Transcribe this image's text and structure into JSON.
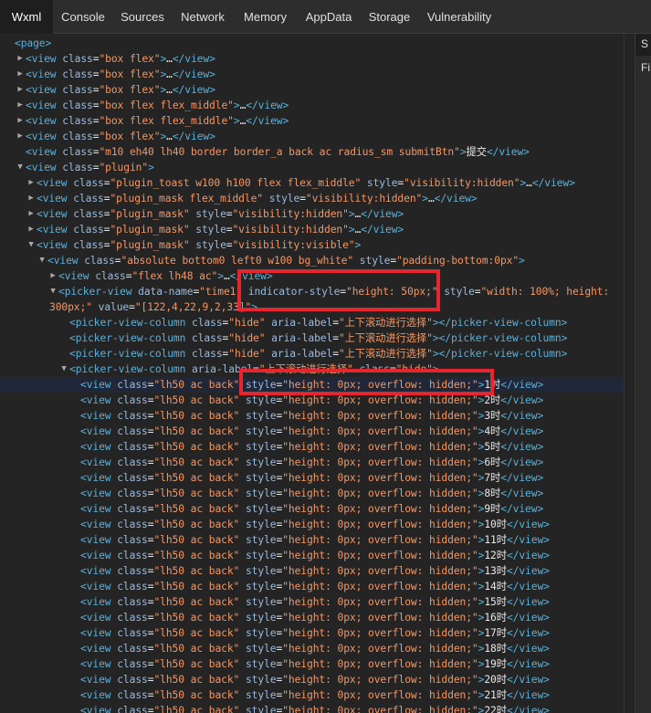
{
  "tabs": [
    "Wxml",
    "Console",
    "Sources",
    "Network",
    "Memory",
    "AppData",
    "Storage",
    "Vulnerability"
  ],
  "active_tab": "Wxml",
  "side_panel": {
    "label1": "S",
    "label2": "Fi"
  },
  "nodes": [
    {
      "caret": "",
      "indent": 16,
      "segs": [
        {
          "c": "t",
          "s": "<page>"
        }
      ]
    },
    {
      "caret": "▶",
      "indent": 28,
      "segs": [
        {
          "c": "t",
          "s": "<view "
        },
        {
          "c": "a",
          "s": "class"
        },
        {
          "c": "x",
          "s": "="
        },
        {
          "c": "v",
          "s": "\"box flex\""
        },
        {
          "c": "t",
          "s": ">"
        },
        {
          "c": "x",
          "s": "…"
        },
        {
          "c": "t",
          "s": "</view>"
        }
      ]
    },
    {
      "caret": "▶",
      "indent": 28,
      "segs": [
        {
          "c": "t",
          "s": "<view "
        },
        {
          "c": "a",
          "s": "class"
        },
        {
          "c": "x",
          "s": "="
        },
        {
          "c": "v",
          "s": "\"box flex\""
        },
        {
          "c": "t",
          "s": ">"
        },
        {
          "c": "x",
          "s": "…"
        },
        {
          "c": "t",
          "s": "</view>"
        }
      ]
    },
    {
      "caret": "▶",
      "indent": 28,
      "segs": [
        {
          "c": "t",
          "s": "<view "
        },
        {
          "c": "a",
          "s": "class"
        },
        {
          "c": "x",
          "s": "="
        },
        {
          "c": "v",
          "s": "\"box flex\""
        },
        {
          "c": "t",
          "s": ">"
        },
        {
          "c": "x",
          "s": "…"
        },
        {
          "c": "t",
          "s": "</view>"
        }
      ]
    },
    {
      "caret": "▶",
      "indent": 28,
      "segs": [
        {
          "c": "t",
          "s": "<view "
        },
        {
          "c": "a",
          "s": "class"
        },
        {
          "c": "x",
          "s": "="
        },
        {
          "c": "v",
          "s": "\"box flex flex_middle\""
        },
        {
          "c": "t",
          "s": ">"
        },
        {
          "c": "x",
          "s": "…"
        },
        {
          "c": "t",
          "s": "</view>"
        }
      ]
    },
    {
      "caret": "▶",
      "indent": 28,
      "segs": [
        {
          "c": "t",
          "s": "<view "
        },
        {
          "c": "a",
          "s": "class"
        },
        {
          "c": "x",
          "s": "="
        },
        {
          "c": "v",
          "s": "\"box flex flex_middle\""
        },
        {
          "c": "t",
          "s": ">"
        },
        {
          "c": "x",
          "s": "…"
        },
        {
          "c": "t",
          "s": "</view>"
        }
      ]
    },
    {
      "caret": "▶",
      "indent": 28,
      "segs": [
        {
          "c": "t",
          "s": "<view "
        },
        {
          "c": "a",
          "s": "class"
        },
        {
          "c": "x",
          "s": "="
        },
        {
          "c": "v",
          "s": "\"box flex\""
        },
        {
          "c": "t",
          "s": ">"
        },
        {
          "c": "x",
          "s": "…"
        },
        {
          "c": "t",
          "s": "</view>"
        }
      ]
    },
    {
      "caret": "",
      "indent": 28,
      "segs": [
        {
          "c": "t",
          "s": "<view "
        },
        {
          "c": "a",
          "s": "class"
        },
        {
          "c": "x",
          "s": "="
        },
        {
          "c": "v",
          "s": "\"m10 eh40 lh40 border border_a back ac radius_sm submitBtn\""
        },
        {
          "c": "t",
          "s": ">"
        },
        {
          "c": "x",
          "s": "提交"
        },
        {
          "c": "t",
          "s": "</view>"
        }
      ]
    },
    {
      "caret": "▼",
      "indent": 28,
      "segs": [
        {
          "c": "t",
          "s": "<view "
        },
        {
          "c": "a",
          "s": "class"
        },
        {
          "c": "x",
          "s": "="
        },
        {
          "c": "v",
          "s": "\"plugin\""
        },
        {
          "c": "t",
          "s": ">"
        }
      ]
    },
    {
      "caret": "▶",
      "indent": 40,
      "segs": [
        {
          "c": "t",
          "s": "<view "
        },
        {
          "c": "a",
          "s": "class"
        },
        {
          "c": "x",
          "s": "="
        },
        {
          "c": "v",
          "s": "\"plugin_toast w100 h100 flex flex_middle\""
        },
        {
          "c": "t",
          "s": " "
        },
        {
          "c": "a",
          "s": "style"
        },
        {
          "c": "x",
          "s": "="
        },
        {
          "c": "v",
          "s": "\"visibility:hidden\""
        },
        {
          "c": "t",
          "s": ">"
        },
        {
          "c": "x",
          "s": "…"
        },
        {
          "c": "t",
          "s": "</view>"
        }
      ]
    },
    {
      "caret": "▶",
      "indent": 40,
      "segs": [
        {
          "c": "t",
          "s": "<view "
        },
        {
          "c": "a",
          "s": "class"
        },
        {
          "c": "x",
          "s": "="
        },
        {
          "c": "v",
          "s": "\"plugin_mask flex_middle\""
        },
        {
          "c": "t",
          "s": " "
        },
        {
          "c": "a",
          "s": "style"
        },
        {
          "c": "x",
          "s": "="
        },
        {
          "c": "v",
          "s": "\"visibility:hidden\""
        },
        {
          "c": "t",
          "s": ">"
        },
        {
          "c": "x",
          "s": "…"
        },
        {
          "c": "t",
          "s": "</view>"
        }
      ]
    },
    {
      "caret": "▶",
      "indent": 40,
      "segs": [
        {
          "c": "t",
          "s": "<view "
        },
        {
          "c": "a",
          "s": "class"
        },
        {
          "c": "x",
          "s": "="
        },
        {
          "c": "v",
          "s": "\"plugin_mask\""
        },
        {
          "c": "t",
          "s": " "
        },
        {
          "c": "a",
          "s": "style"
        },
        {
          "c": "x",
          "s": "="
        },
        {
          "c": "v",
          "s": "\"visibility:hidden\""
        },
        {
          "c": "t",
          "s": ">"
        },
        {
          "c": "x",
          "s": "…"
        },
        {
          "c": "t",
          "s": "</view>"
        }
      ]
    },
    {
      "caret": "▶",
      "indent": 40,
      "segs": [
        {
          "c": "t",
          "s": "<view "
        },
        {
          "c": "a",
          "s": "class"
        },
        {
          "c": "x",
          "s": "="
        },
        {
          "c": "v",
          "s": "\"plugin_mask\""
        },
        {
          "c": "t",
          "s": " "
        },
        {
          "c": "a",
          "s": "style"
        },
        {
          "c": "x",
          "s": "="
        },
        {
          "c": "v",
          "s": "\"visibility:hidden\""
        },
        {
          "c": "t",
          "s": ">"
        },
        {
          "c": "x",
          "s": "…"
        },
        {
          "c": "t",
          "s": "</view>"
        }
      ]
    },
    {
      "caret": "▼",
      "indent": 40,
      "segs": [
        {
          "c": "t",
          "s": "<view "
        },
        {
          "c": "a",
          "s": "class"
        },
        {
          "c": "x",
          "s": "="
        },
        {
          "c": "v",
          "s": "\"plugin_mask\""
        },
        {
          "c": "t",
          "s": " "
        },
        {
          "c": "a",
          "s": "style"
        },
        {
          "c": "x",
          "s": "="
        },
        {
          "c": "v",
          "s": "\"visibility:visible\""
        },
        {
          "c": "t",
          "s": ">"
        }
      ]
    },
    {
      "caret": "▼",
      "indent": 52,
      "segs": [
        {
          "c": "t",
          "s": "<view "
        },
        {
          "c": "a",
          "s": "class"
        },
        {
          "c": "x",
          "s": "="
        },
        {
          "c": "v",
          "s": "\"absolute bottom0 left0 w100 bg_white\""
        },
        {
          "c": "t",
          "s": " "
        },
        {
          "c": "a",
          "s": "style"
        },
        {
          "c": "x",
          "s": "="
        },
        {
          "c": "v",
          "s": "\"padding-bottom:0px\""
        },
        {
          "c": "t",
          "s": ">"
        }
      ]
    },
    {
      "caret": "▶",
      "indent": 64,
      "segs": [
        {
          "c": "t",
          "s": "<view "
        },
        {
          "c": "a",
          "s": "class"
        },
        {
          "c": "x",
          "s": "="
        },
        {
          "c": "v",
          "s": "\"flex lh48 ac\""
        },
        {
          "c": "t",
          "s": ">"
        },
        {
          "c": "x",
          "s": "…"
        },
        {
          "c": "t",
          "s": "</view>"
        }
      ]
    },
    {
      "caret": "▼",
      "indent": 64,
      "wrap": true,
      "segs": [
        {
          "c": "t",
          "s": "<picker-view "
        },
        {
          "c": "a",
          "s": "data-name"
        },
        {
          "c": "x",
          "s": "="
        },
        {
          "c": "v",
          "s": "\"time1\""
        },
        {
          "c": "t",
          "s": " "
        },
        {
          "c": "a",
          "s": "indicator-style"
        },
        {
          "c": "x",
          "s": "="
        },
        {
          "c": "v",
          "s": "\"height: 50px;\""
        },
        {
          "c": "t",
          "s": " "
        },
        {
          "c": "a",
          "s": "style"
        },
        {
          "c": "x",
          "s": "="
        },
        {
          "c": "v",
          "s": "\"width: 100%; height: 300px;\""
        },
        {
          "c": "t",
          "s": " "
        },
        {
          "c": "a",
          "s": "value"
        },
        {
          "c": "x",
          "s": "="
        },
        {
          "c": "v",
          "s": "\"[122,4,22,9,2,33]\""
        },
        {
          "c": "t",
          "s": ">"
        }
      ]
    },
    {
      "caret": "",
      "indent": 76,
      "segs": [
        {
          "c": "t",
          "s": "<picker-view-column "
        },
        {
          "c": "a",
          "s": "class"
        },
        {
          "c": "x",
          "s": "="
        },
        {
          "c": "v",
          "s": "\"hide\""
        },
        {
          "c": "t",
          "s": " "
        },
        {
          "c": "a",
          "s": "aria-label"
        },
        {
          "c": "x",
          "s": "="
        },
        {
          "c": "v",
          "s": "\"上下滚动进行选择\""
        },
        {
          "c": "t",
          "s": "></picker-view-column>"
        }
      ]
    },
    {
      "caret": "",
      "indent": 76,
      "segs": [
        {
          "c": "t",
          "s": "<picker-view-column "
        },
        {
          "c": "a",
          "s": "class"
        },
        {
          "c": "x",
          "s": "="
        },
        {
          "c": "v",
          "s": "\"hide\""
        },
        {
          "c": "t",
          "s": " "
        },
        {
          "c": "a",
          "s": "aria-label"
        },
        {
          "c": "x",
          "s": "="
        },
        {
          "c": "v",
          "s": "\"上下滚动进行选择\""
        },
        {
          "c": "t",
          "s": "></picker-view-column>"
        }
      ]
    },
    {
      "caret": "",
      "indent": 76,
      "segs": [
        {
          "c": "t",
          "s": "<picker-view-column "
        },
        {
          "c": "a",
          "s": "class"
        },
        {
          "c": "x",
          "s": "="
        },
        {
          "c": "v",
          "s": "\"hide\""
        },
        {
          "c": "t",
          "s": " "
        },
        {
          "c": "a",
          "s": "aria-label"
        },
        {
          "c": "x",
          "s": "="
        },
        {
          "c": "v",
          "s": "\"上下滚动进行选择\""
        },
        {
          "c": "t",
          "s": "></picker-view-column>"
        }
      ]
    },
    {
      "caret": "▼",
      "indent": 76,
      "segs": [
        {
          "c": "t",
          "s": "<picker-view-column "
        },
        {
          "c": "a",
          "s": "aria-label"
        },
        {
          "c": "x",
          "s": "="
        },
        {
          "c": "v",
          "s": "\"上下滚动进行选择\""
        },
        {
          "c": "t",
          "s": " "
        },
        {
          "c": "a",
          "s": "class"
        },
        {
          "c": "x",
          "s": "="
        },
        {
          "c": "v",
          "s": "\"hide\""
        },
        {
          "c": "t",
          "s": ">"
        }
      ]
    }
  ],
  "hour_rows": {
    "class_value": "\"lh50 ac back\"",
    "style_value": "\"height: 0px; overflow: hidden;\"",
    "labels": [
      "1时",
      "2时",
      "3时",
      "4时",
      "5时",
      "6时",
      "7时",
      "8时",
      "9时",
      "10时",
      "11时",
      "12时",
      "13时",
      "14时",
      "15时",
      "16时",
      "17时",
      "18时",
      "19时",
      "20时",
      "21时",
      "22时"
    ]
  }
}
